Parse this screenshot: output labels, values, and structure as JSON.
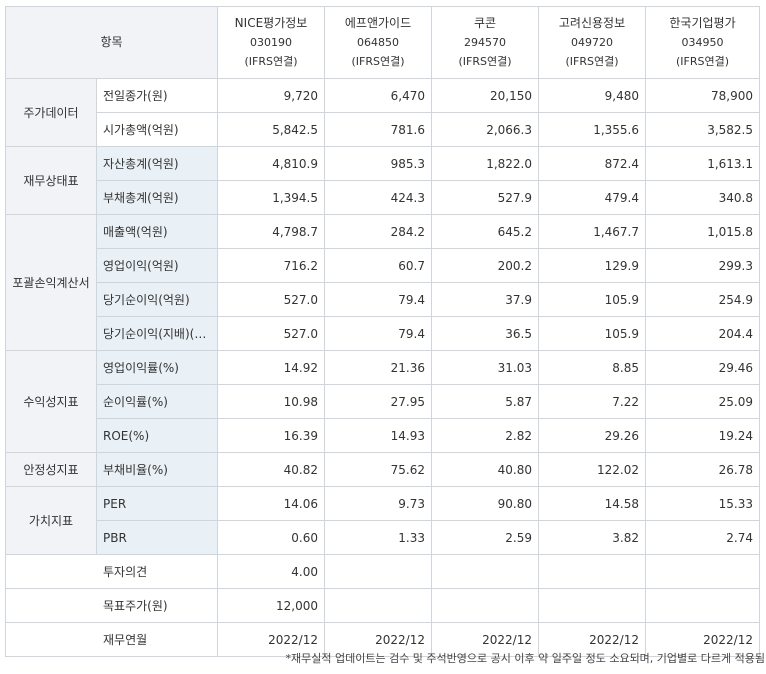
{
  "header": {
    "corner_label": "항목",
    "companies": [
      {
        "name": "NICE평가정보",
        "code": "030190",
        "standard": "(IFRS연결)"
      },
      {
        "name": "에프앤가이드",
        "code": "064850",
        "standard": "(IFRS연결)"
      },
      {
        "name": "쿠콘",
        "code": "294570",
        "standard": "(IFRS연결)"
      },
      {
        "name": "고려신용정보",
        "code": "049720",
        "standard": "(IFRS연결)"
      },
      {
        "name": "한국기업평가",
        "code": "034950",
        "standard": "(IFRS연결)"
      }
    ]
  },
  "categories": {
    "stock": "주가데이터",
    "balance": "재무상태표",
    "income": "포괄손익계산서",
    "profitability": "수익성지표",
    "stability": "안정성지표",
    "valuation": "가치지표"
  },
  "rows": [
    {
      "label": "전일종가(원)",
      "values": [
        "9,720",
        "6,470",
        "20,150",
        "9,480",
        "78,900"
      ]
    },
    {
      "label": "시가총액(억원)",
      "values": [
        "5,842.5",
        "781.6",
        "2,066.3",
        "1,355.6",
        "3,582.5"
      ]
    },
    {
      "label": "자산총계(억원)",
      "values": [
        "4,810.9",
        "985.3",
        "1,822.0",
        "872.4",
        "1,613.1"
      ]
    },
    {
      "label": "부채총계(억원)",
      "values": [
        "1,394.5",
        "424.3",
        "527.9",
        "479.4",
        "340.8"
      ]
    },
    {
      "label": "매출액(억원)",
      "values": [
        "4,798.7",
        "284.2",
        "645.2",
        "1,467.7",
        "1,015.8"
      ]
    },
    {
      "label": "영업이익(억원)",
      "values": [
        "716.2",
        "60.7",
        "200.2",
        "129.9",
        "299.3"
      ]
    },
    {
      "label": "당기순이익(억원)",
      "values": [
        "527.0",
        "79.4",
        "37.9",
        "105.9",
        "254.9"
      ]
    },
    {
      "label": "당기순이익(지배)(…",
      "values": [
        "527.0",
        "79.4",
        "36.5",
        "105.9",
        "204.4"
      ]
    },
    {
      "label": "영업이익률(%)",
      "values": [
        "14.92",
        "21.36",
        "31.03",
        "8.85",
        "29.46"
      ]
    },
    {
      "label": "순이익률(%)",
      "values": [
        "10.98",
        "27.95",
        "5.87",
        "7.22",
        "25.09"
      ]
    },
    {
      "label": "ROE(%)",
      "values": [
        "16.39",
        "14.93",
        "2.82",
        "29.26",
        "19.24"
      ]
    },
    {
      "label": "부채비율(%)",
      "values": [
        "40.82",
        "75.62",
        "40.80",
        "122.02",
        "26.78"
      ]
    },
    {
      "label": "PER",
      "values": [
        "14.06",
        "9.73",
        "90.80",
        "14.58",
        "15.33"
      ]
    },
    {
      "label": "PBR",
      "values": [
        "0.60",
        "1.33",
        "2.59",
        "3.82",
        "2.74"
      ]
    }
  ],
  "bottom_rows": [
    {
      "label": "투자의견",
      "values": [
        "4.00",
        "",
        "",
        "",
        ""
      ]
    },
    {
      "label": "목표주가(원)",
      "values": [
        "12,000",
        "",
        "",
        "",
        ""
      ]
    },
    {
      "label": "재무연월",
      "values": [
        "2022/12",
        "2022/12",
        "2022/12",
        "2022/12",
        "2022/12"
      ]
    }
  ],
  "footnote": "*재무실적 업데이트는 검수 및 주석반영으로 공시 이후 약 일주일 정도 소요되며, 기업별로 다르게 적용됨"
}
